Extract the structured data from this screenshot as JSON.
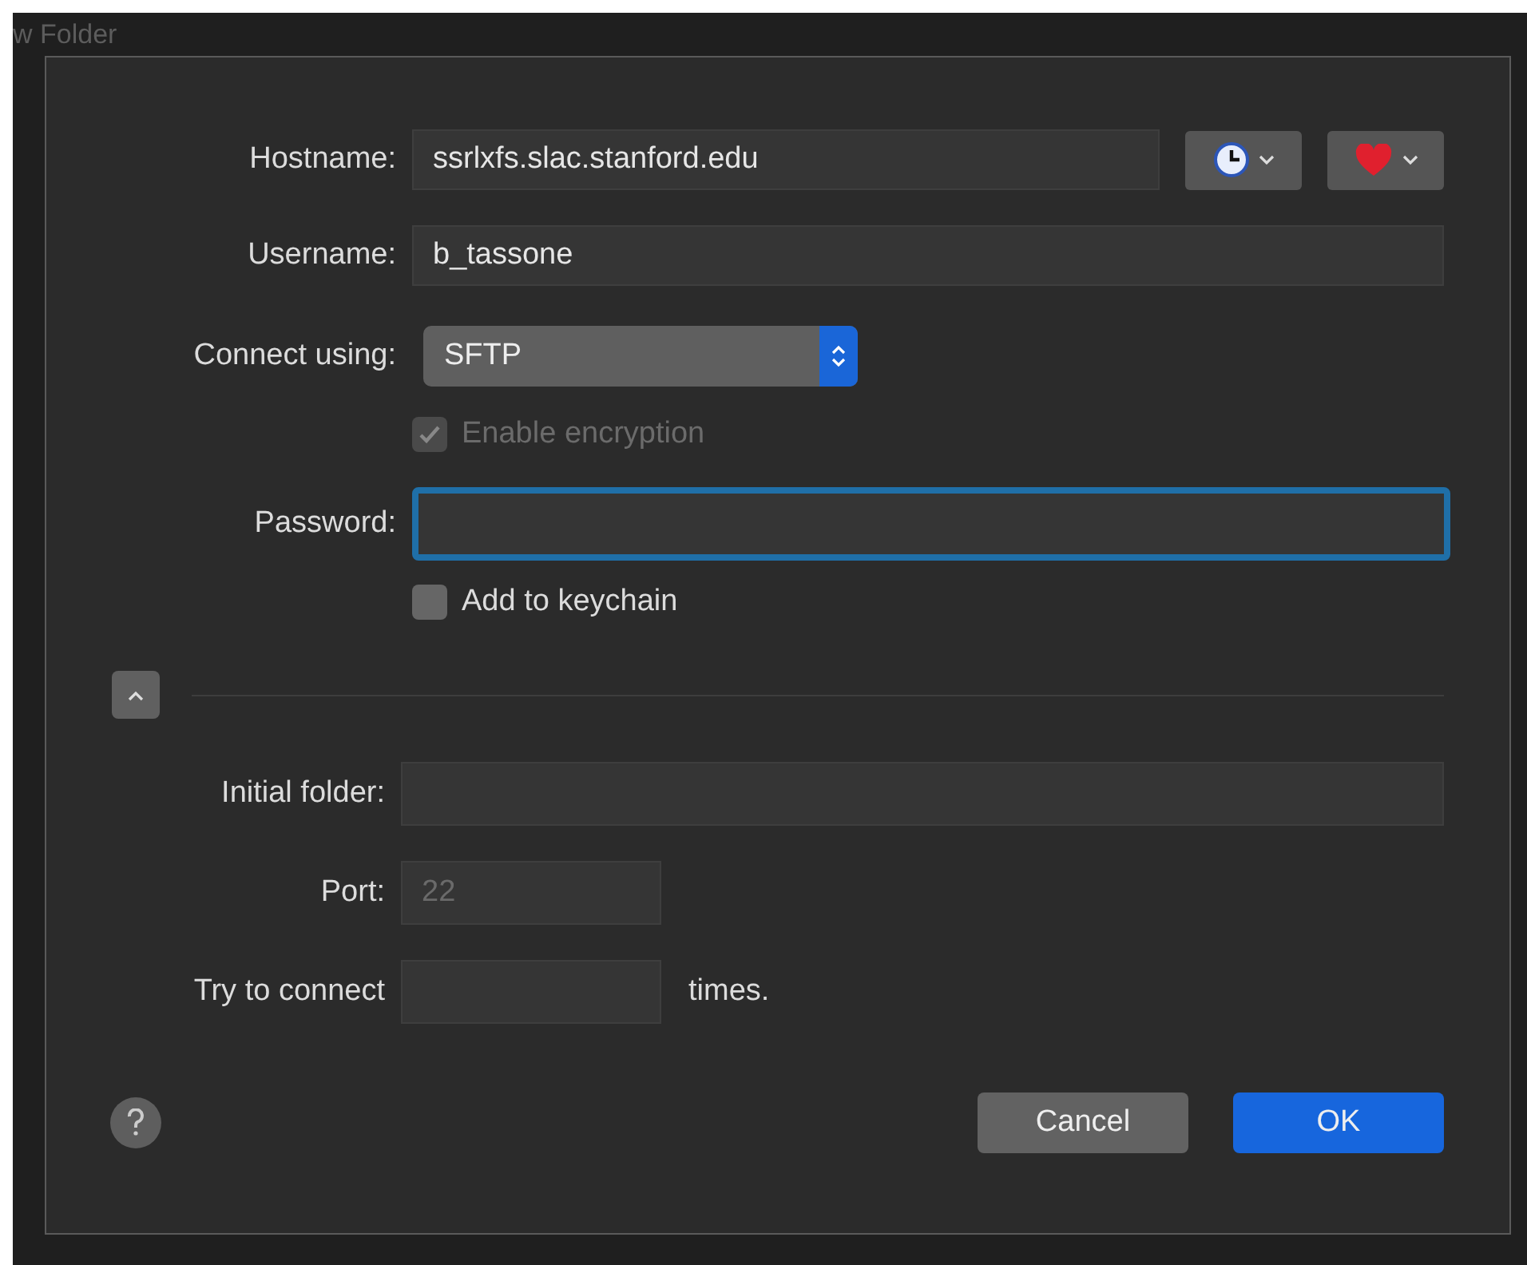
{
  "background_window": {
    "title": "w Folder"
  },
  "hostname": {
    "label": "Hostname:",
    "value": "ssrlxfs.slac.stanford.edu"
  },
  "username": {
    "label": "Username:",
    "value": "b_tassone"
  },
  "connect_using": {
    "label": "Connect using:",
    "value": "SFTP"
  },
  "encryption": {
    "label": "Enable encryption",
    "checked": true,
    "disabled": true
  },
  "password": {
    "label": "Password:",
    "focused": true
  },
  "keychain": {
    "label": "Add to keychain",
    "checked": false,
    "disabled": false
  },
  "advanced": {
    "expanded": true
  },
  "initial_folder": {
    "label": "Initial folder:"
  },
  "port": {
    "label": "Port:",
    "placeholder": "22"
  },
  "retries": {
    "label": "Try to connect",
    "suffix": "times."
  },
  "buttons": [
    {
      "label": "Cancel",
      "kind": "secondary"
    },
    {
      "label": "OK",
      "kind": "primary"
    }
  ]
}
